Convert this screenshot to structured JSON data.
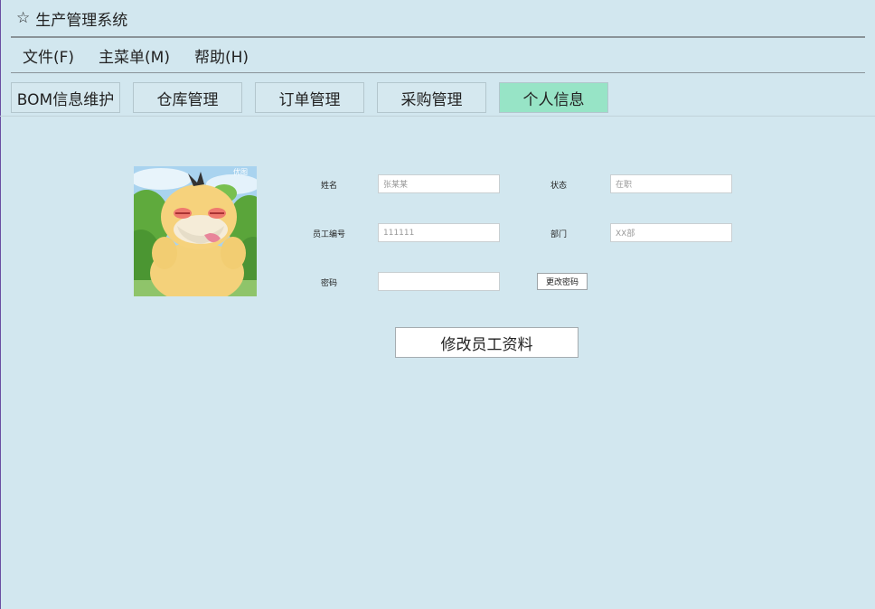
{
  "window": {
    "title": "生产管理系统",
    "icon": "star-icon"
  },
  "menubar": {
    "items": [
      {
        "label": "文件(F)"
      },
      {
        "label": "主菜单(M)"
      },
      {
        "label": "帮助(H)"
      }
    ]
  },
  "tabs": [
    {
      "label": "BOM信息维护",
      "active": false
    },
    {
      "label": "仓库管理",
      "active": false
    },
    {
      "label": "订单管理",
      "active": false
    },
    {
      "label": "采购管理",
      "active": false
    },
    {
      "label": "个人信息",
      "active": true
    }
  ],
  "profile": {
    "avatar_watermark": "优图",
    "name_label": "姓名",
    "name_placeholder": "张某某",
    "status_label": "状态",
    "status_placeholder": "在职",
    "employee_id_label": "员工编号",
    "employee_id_placeholder": "111111",
    "department_label": "部门",
    "department_placeholder": "XX部",
    "password_label": "密码",
    "password_value": "",
    "change_password_button": "更改密码",
    "edit_profile_button": "修改员工资料"
  },
  "colors": {
    "background": "#d2e7ef",
    "active_tab": "#97e4c6"
  }
}
